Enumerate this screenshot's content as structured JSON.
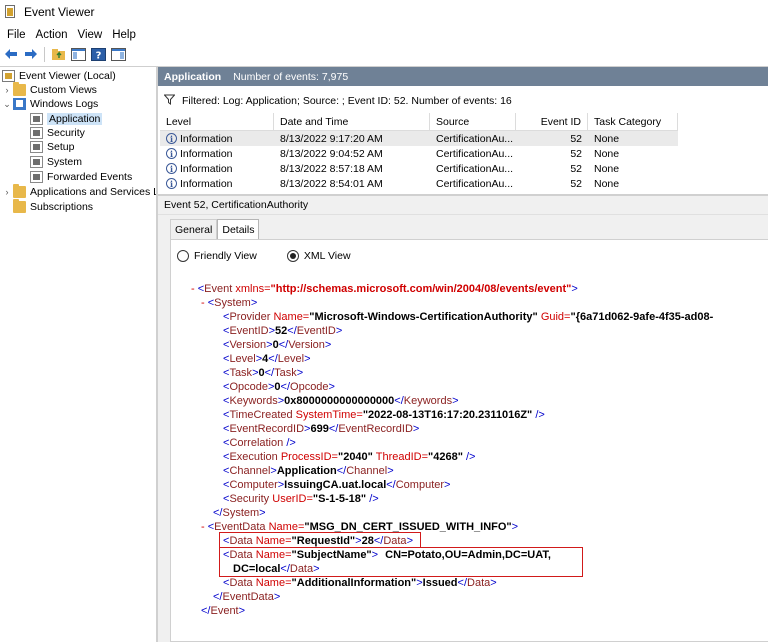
{
  "window": {
    "title": "Event Viewer"
  },
  "menu": [
    "File",
    "Action",
    "View",
    "Help"
  ],
  "tree": {
    "root": "Event Viewer (Local)",
    "custom_views": "Custom Views",
    "windows_logs": "Windows Logs",
    "application": "Application",
    "security": "Security",
    "setup": "Setup",
    "system": "System",
    "forwarded": "Forwarded Events",
    "apps_services": "Applications and Services Lo",
    "subscriptions": "Subscriptions"
  },
  "header": {
    "log_name": "Application",
    "count_text": "Number of events: 7,975"
  },
  "filter": {
    "text": "Filtered: Log: Application; Source: ; Event ID: 52. Number of events: 16"
  },
  "table": {
    "columns": [
      "Level",
      "Date and Time",
      "Source",
      "Event ID",
      "Task Category"
    ],
    "rows": [
      {
        "level": "Information",
        "date": "8/13/2022 9:17:20 AM",
        "source": "CertificationAu...",
        "id": "52",
        "task": "None"
      },
      {
        "level": "Information",
        "date": "8/13/2022 9:04:52 AM",
        "source": "CertificationAu...",
        "id": "52",
        "task": "None"
      },
      {
        "level": "Information",
        "date": "8/13/2022 8:57:18 AM",
        "source": "CertificationAu...",
        "id": "52",
        "task": "None"
      },
      {
        "level": "Information",
        "date": "8/13/2022 8:54:01 AM",
        "source": "CertificationAu...",
        "id": "52",
        "task": "None"
      }
    ]
  },
  "event_header": "Event 52, CertificationAuthority",
  "tabs": [
    "General",
    "Details"
  ],
  "radios": {
    "friendly": "Friendly View",
    "xml": "XML View"
  },
  "xml": {
    "event_xmlns_attr": "xmlns=",
    "event_xmlns_val": "\"http://schemas.microsoft.com/win/2004/08/events/event\"",
    "provider_name": "\"Microsoft-Windows-CertificationAuthority\"",
    "provider_guid": "\"{6a71d062-9afe-4f35-ad08-",
    "event_id": "52",
    "version": "0",
    "level": "4",
    "task": "0",
    "opcode": "0",
    "keywords": "0x8000000000000000",
    "time_created": "\"2022-08-13T16:17:20.2311016Z\"",
    "record_id": "699",
    "process_id": "\"2040\"",
    "thread_id": "\"4268\"",
    "channel": "Application",
    "computer": "IssuingCA.uat.local",
    "user_id": "\"S-1-5-18\"",
    "eventdata_name": "\"MSG_DN_CERT_ISSUED_WITH_INFO\"",
    "requestid_name": "\"RequestId\"",
    "requestid_val": "28",
    "subject_name": "\"SubjectName\"",
    "subject_val_1": "CN=Potato,OU=Admin,DC=UAT,",
    "subject_val_2": "DC=local",
    "addinfo_name": "\"AdditionalInformation\"",
    "addinfo_val": "Issued"
  }
}
